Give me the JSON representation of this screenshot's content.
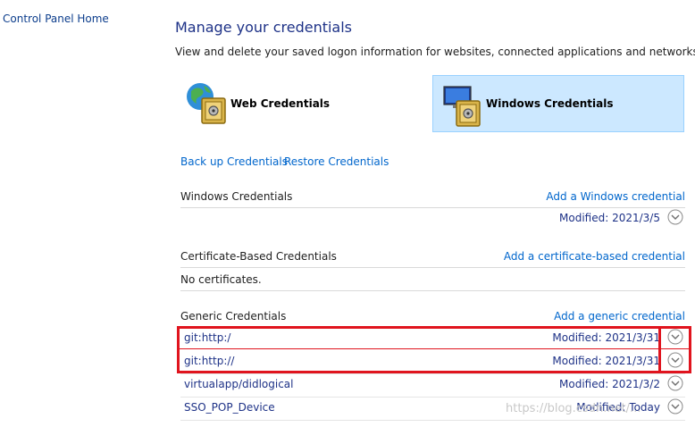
{
  "sidebar": {
    "home_label": "Control Panel Home"
  },
  "header": {
    "title": "Manage your credentials",
    "subtitle": "View and delete your saved logon information for websites, connected applications and networks."
  },
  "tiles": {
    "web": {
      "label": "Web Credentials",
      "icon": "web-vault-icon"
    },
    "windows": {
      "label": "Windows Credentials",
      "icon": "windows-vault-icon",
      "selected": true
    }
  },
  "actions": {
    "backup": "Back up Credentials",
    "restore": "Restore Credentials"
  },
  "sections": {
    "windows": {
      "title": "Windows Credentials",
      "add": "Add a Windows credential",
      "rows": [
        {
          "name": "",
          "modified": "Modified:  2021/3/5"
        }
      ]
    },
    "certificate": {
      "title": "Certificate-Based Credentials",
      "add": "Add a certificate-based credential",
      "empty": "No certificates."
    },
    "generic": {
      "title": "Generic Credentials",
      "add": "Add a generic credential",
      "rows": [
        {
          "name": "git:http:/",
          "modified": "Modified:  2021/3/31"
        },
        {
          "name": "git:http://",
          "modified": "Modified:  2021/3/31"
        },
        {
          "name": "virtualapp/didlogical",
          "modified": "Modified:  2021/3/2"
        },
        {
          "name": "SSO_POP_Device",
          "modified": "Modified:  Today"
        }
      ]
    }
  },
  "watermark": "https://blog.csdn.net/...",
  "colors": {
    "link": "#0066cc",
    "highlight": "#e0141e",
    "selected_tile": "#cce8ff"
  }
}
